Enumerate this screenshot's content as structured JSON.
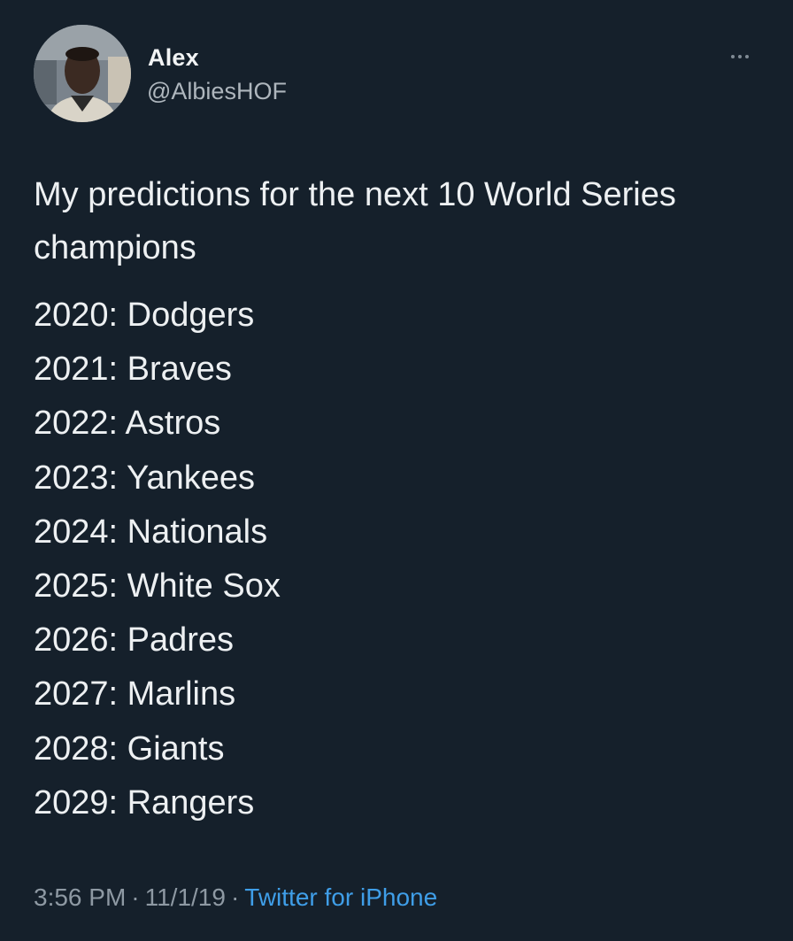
{
  "author": {
    "name": "Alex",
    "handle": "@AlbiesHOF"
  },
  "tweet": {
    "intro": "My predictions for the next 10 World Series champions",
    "predictions": [
      "2020: Dodgers",
      "2021: Braves",
      "2022: Astros",
      "2023: Yankees",
      "2024: Nationals",
      "2025: White Sox",
      "2026: Padres",
      "2027: Marlins",
      "2028: Giants",
      "2029: Rangers"
    ]
  },
  "meta": {
    "time": "3:56 PM",
    "separator": "·",
    "date": "11/1/19",
    "source": "Twitter for iPhone"
  },
  "icons": {
    "more": "more-options-icon",
    "avatar": "profile-photo"
  },
  "colors": {
    "background": "#15202b",
    "text": "#edf0f2",
    "secondary": "#8e99a3",
    "link": "#3f9ee8"
  }
}
